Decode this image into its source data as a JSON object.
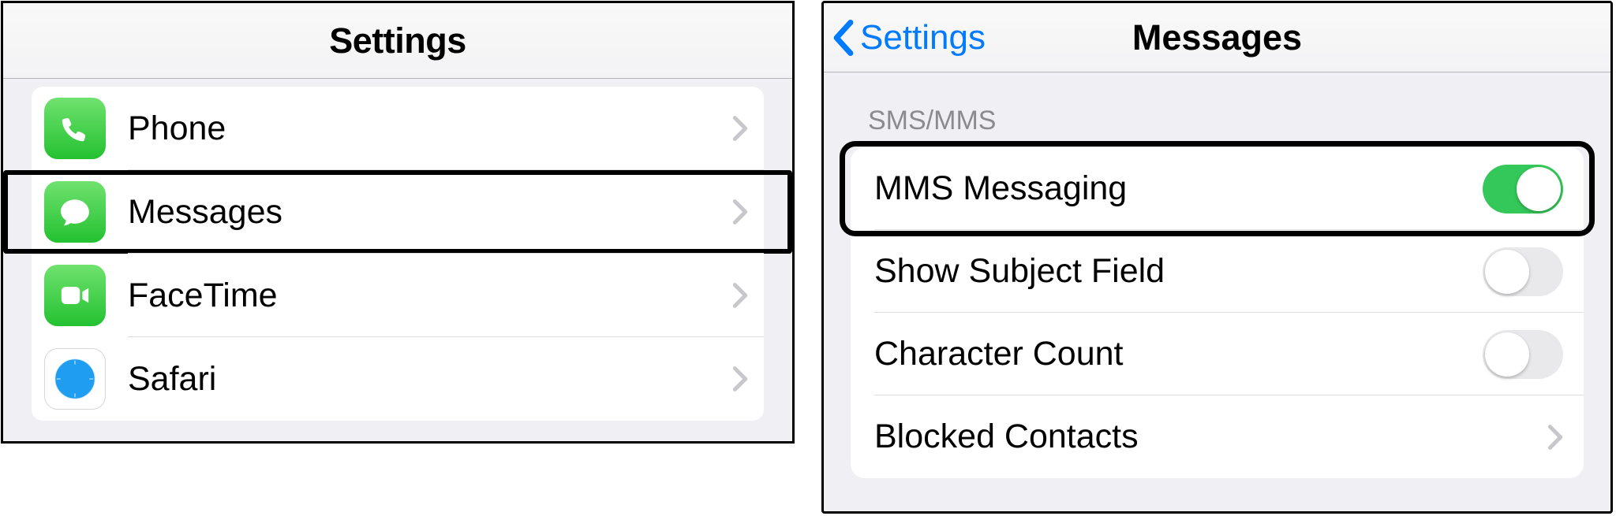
{
  "left": {
    "title": "Settings",
    "items": [
      {
        "label": "Phone",
        "icon": "phone-icon",
        "highlighted": false
      },
      {
        "label": "Messages",
        "icon": "messages-icon",
        "highlighted": true
      },
      {
        "label": "FaceTime",
        "icon": "facetime-icon",
        "highlighted": false
      },
      {
        "label": "Safari",
        "icon": "safari-icon",
        "highlighted": false
      }
    ]
  },
  "right": {
    "back_label": "Settings",
    "title": "Messages",
    "section_header": "SMS/MMS",
    "rows": [
      {
        "label": "MMS Messaging",
        "type": "toggle",
        "on": true,
        "highlighted": true
      },
      {
        "label": "Show Subject Field",
        "type": "toggle",
        "on": false,
        "highlighted": false
      },
      {
        "label": "Character Count",
        "type": "toggle",
        "on": false,
        "highlighted": false
      },
      {
        "label": "Blocked Contacts",
        "type": "nav",
        "highlighted": false
      }
    ]
  },
  "colors": {
    "ios_blue": "#007aff",
    "ios_green_toggle": "#34c759",
    "ios_icon_green_top": "#6fe26e",
    "ios_icon_green_bottom": "#24c131",
    "settings_bg": "#efeff4"
  }
}
